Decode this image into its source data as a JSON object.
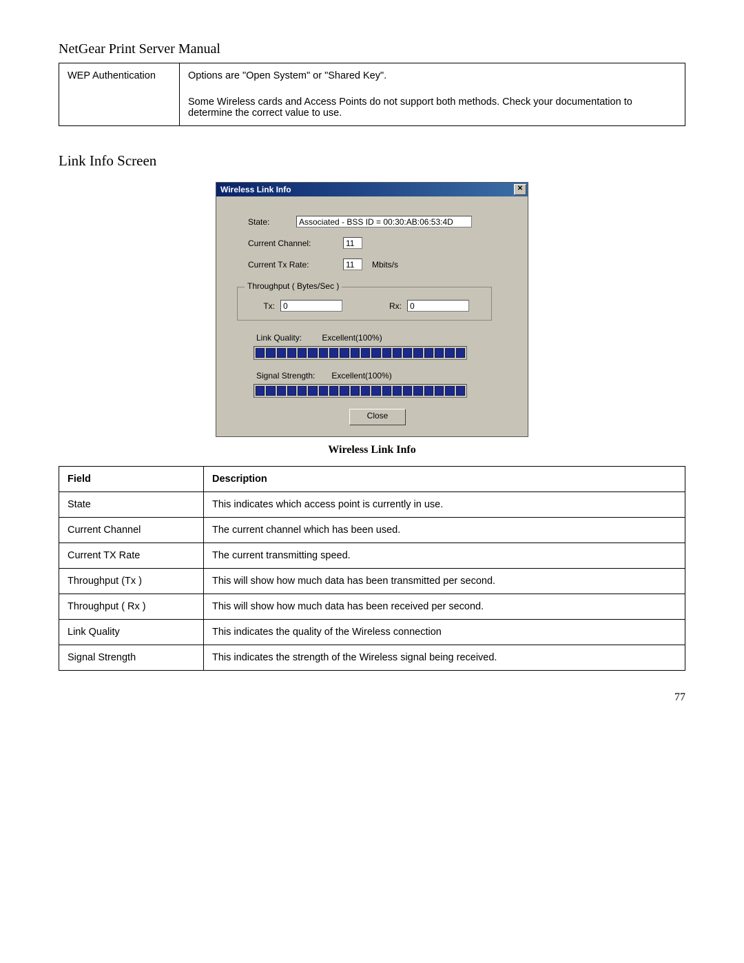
{
  "doc_title": "NetGear Print Server Manual",
  "wep_row": {
    "label": "WEP Authentication",
    "desc_line1": "Options are \"Open System\" or \"Shared Key\".",
    "desc_line2": "Some Wireless cards and Access Points do not support both methods. Check your documentation to determine the correct value to use."
  },
  "section_heading": "Link Info Screen",
  "dialog": {
    "title": "Wireless Link Info",
    "state_label": "State:",
    "state_value": "Associated - BSS ID = 00:30:AB:06:53:4D",
    "channel_label": "Current Channel:",
    "channel_value": "11",
    "txrate_label": "Current Tx Rate:",
    "txrate_value": "11",
    "txrate_unit": "Mbits/s",
    "throughput_legend": "Throughput ( Bytes/Sec )",
    "tx_label": "Tx:",
    "tx_value": "0",
    "rx_label": "Rx:",
    "rx_value": "0",
    "link_quality_label": "Link Quality:",
    "link_quality_value": "Excellent(100%)",
    "signal_strength_label": "Signal Strength:",
    "signal_strength_value": "Excellent(100%)",
    "close_label": "Close"
  },
  "caption": "Wireless Link Info",
  "field_table": {
    "header_field": "Field",
    "header_desc": "Description",
    "rows": [
      {
        "field": "State",
        "desc": "This indicates which access point is currently in use."
      },
      {
        "field": "Current Channel",
        "desc": "The current channel which has been used."
      },
      {
        "field": "Current TX Rate",
        "desc": "The current transmitting speed."
      },
      {
        "field": "Throughput (Tx )",
        "desc": "This will show how much data has been transmitted per second."
      },
      {
        "field": "Throughput ( Rx )",
        "desc": "This will show how much data has been received per second."
      },
      {
        "field": "Link Quality",
        "desc": "This indicates the quality of the Wireless connection"
      },
      {
        "field": "Signal Strength",
        "desc": "This indicates the strength of the Wireless signal being received."
      }
    ]
  },
  "page_number": "77"
}
